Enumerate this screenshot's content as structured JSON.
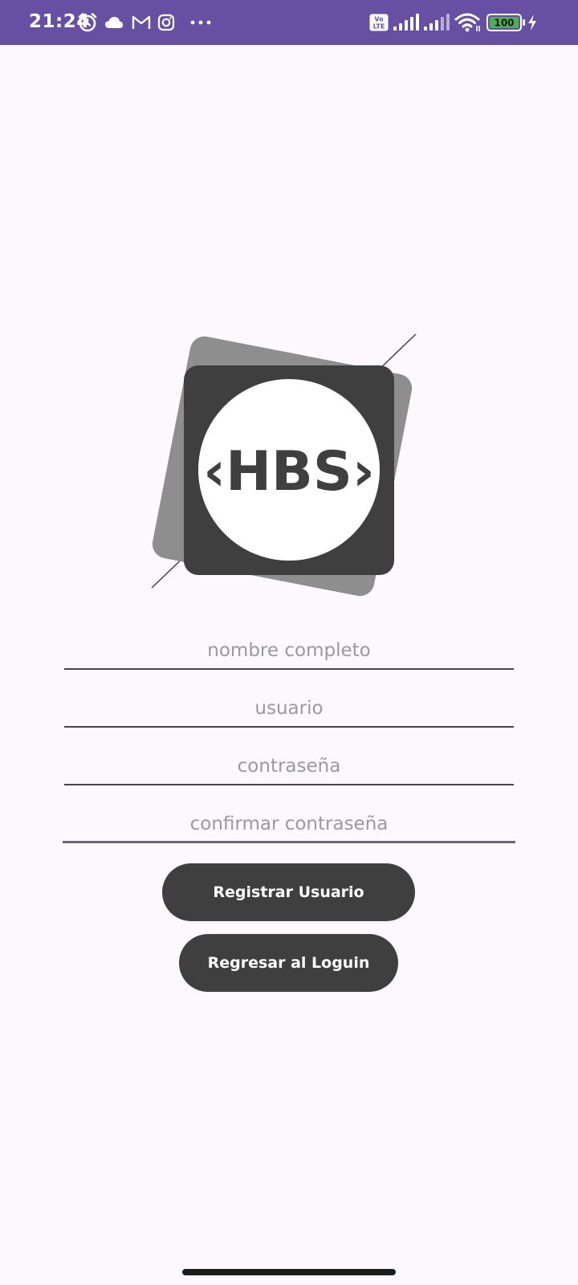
{
  "status_bar": {
    "time": "21:24",
    "background": "#6750a4",
    "left_icons": [
      "alarm-icon",
      "cloud-icon",
      "gmail-icon",
      "instagram-icon",
      "more-dots-icon"
    ],
    "right_icons": [
      "volte-icon",
      "signal-sim1-icon",
      "signal-sim2-icon",
      "wifi-icon",
      "battery-icon",
      "charging-icon"
    ],
    "volte_label_top": "Vo",
    "volte_label_bottom": "LTE",
    "battery_level": "100"
  },
  "logo": {
    "text": "‹HBS›",
    "colors": {
      "back_tile": "#8e8e8e",
      "front_tile": "#3f3f3f",
      "circle": "#ffffff"
    }
  },
  "form": {
    "full_name_placeholder": "nombre completo",
    "username_placeholder": "usuario",
    "password_placeholder": "contraseña",
    "confirm_password_placeholder": "confirmar contraseña"
  },
  "buttons": {
    "register_label": "Registrar Usuario",
    "back_to_login_label": "Regresar al Loguin",
    "color": "#3f3f3f"
  }
}
